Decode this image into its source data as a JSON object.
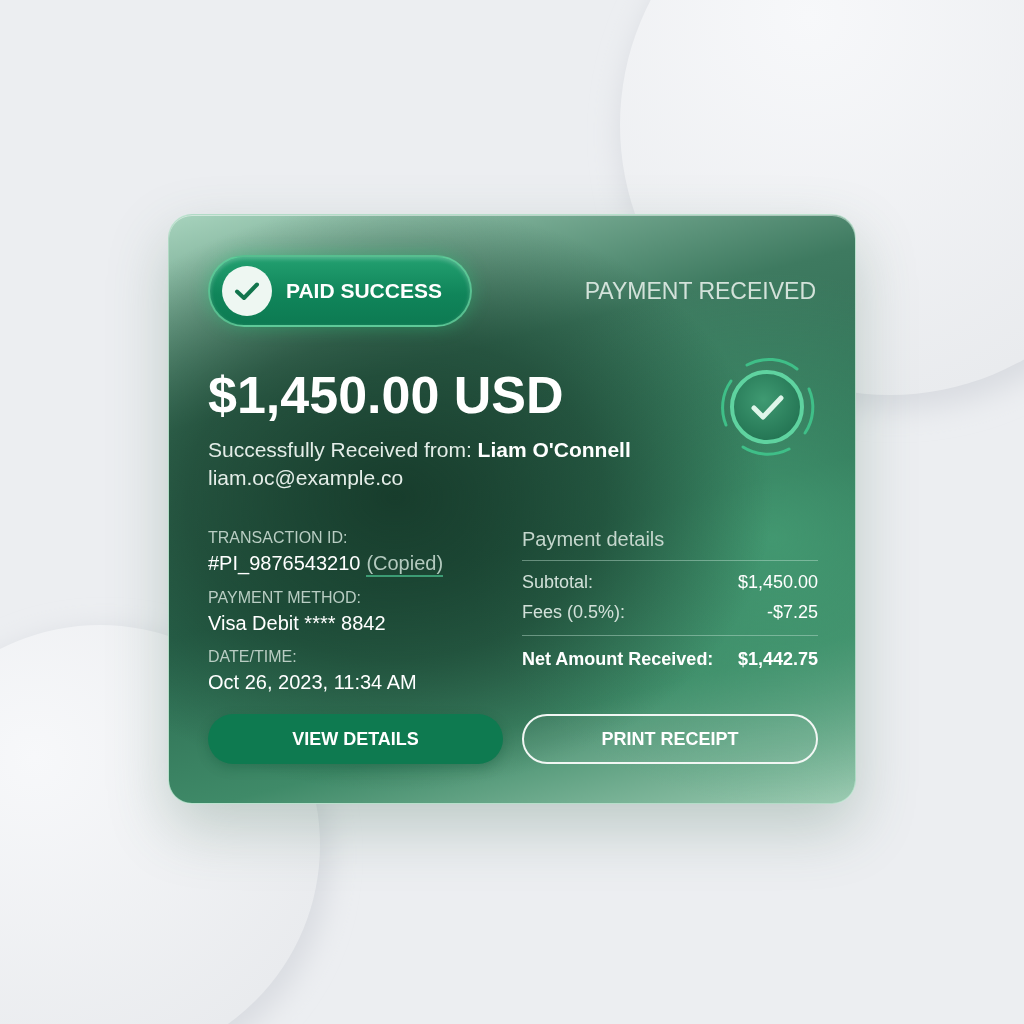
{
  "card": {
    "status_badge": {
      "label": "PAID SUCCESS"
    },
    "heading": "PAYMENT RECEIVED",
    "amount": "$1,450.00 USD",
    "sender_line": "Successfully Received from: **Liam O'Connell**",
    "email": "liam.oc@example.co",
    "fields": [
      {
        "label": "TRANSACTION ID:",
        "value": "#PI_9876543210",
        "note": "(Copied)"
      },
      {
        "label": "PAYMENT METHOD:",
        "value": "Visa Debit **** 8842"
      },
      {
        "label": "DATE/TIME:",
        "value": "Oct 26, 2023, 11:34 AM"
      }
    ],
    "payment_details": {
      "title": "Payment details",
      "lines": [
        {
          "label": "Subtotal:",
          "value": "$1,450.00"
        },
        {
          "label": "Fees (0.5%):",
          "value": "-$7.25"
        }
      ],
      "total": {
        "label": "Net Amount Received:",
        "value": "$1,442.75"
      }
    },
    "buttons": [
      {
        "label": "VIEW DETAILS",
        "kind": "primary"
      },
      {
        "label": "PRINT RECEIPT",
        "kind": "outline"
      }
    ]
  }
}
